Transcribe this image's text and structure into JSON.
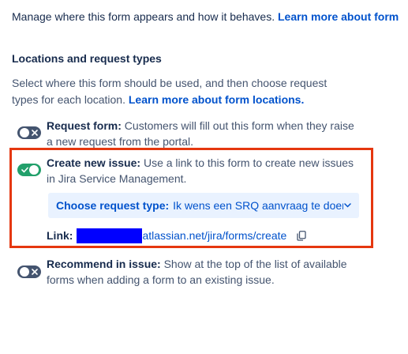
{
  "intro": {
    "text": "Manage where this form appears and how it behaves. ",
    "link": "Learn more about form"
  },
  "locations": {
    "title": "Locations and request types",
    "description": "Select where this form should be used, and then choose request types for each location. ",
    "link": "Learn more about form locations."
  },
  "options": {
    "request_form": {
      "label": "Request form:",
      "text": " Customers will fill out this form when they raise a new request from the portal.",
      "enabled": false
    },
    "create_issue": {
      "label": "Create new issue:",
      "text": " Use a link to this form to create new issues in Jira Service Management.",
      "enabled": true,
      "select_label": "Choose request type:",
      "select_value": "Ik wens een SRQ aanvraag te doen",
      "link_label": "Link:",
      "link_url": "atlassian.net/jira/forms/create"
    },
    "recommend": {
      "label": "Recommend in issue:",
      "text": " Show at the top of the list of available forms when adding a form to an existing issue.",
      "enabled": false
    }
  },
  "icons": {
    "toggle_off": "close-icon",
    "toggle_on": "check-icon",
    "select": "chevron-down-icon",
    "copy": "copy-icon"
  },
  "colors": {
    "link": "#0052cc",
    "toggle_on": "#22a06b",
    "toggle_off": "#44546f",
    "highlight": "#e5370f",
    "redaction": "#0000ff",
    "select_bg": "#e9f2ff"
  }
}
